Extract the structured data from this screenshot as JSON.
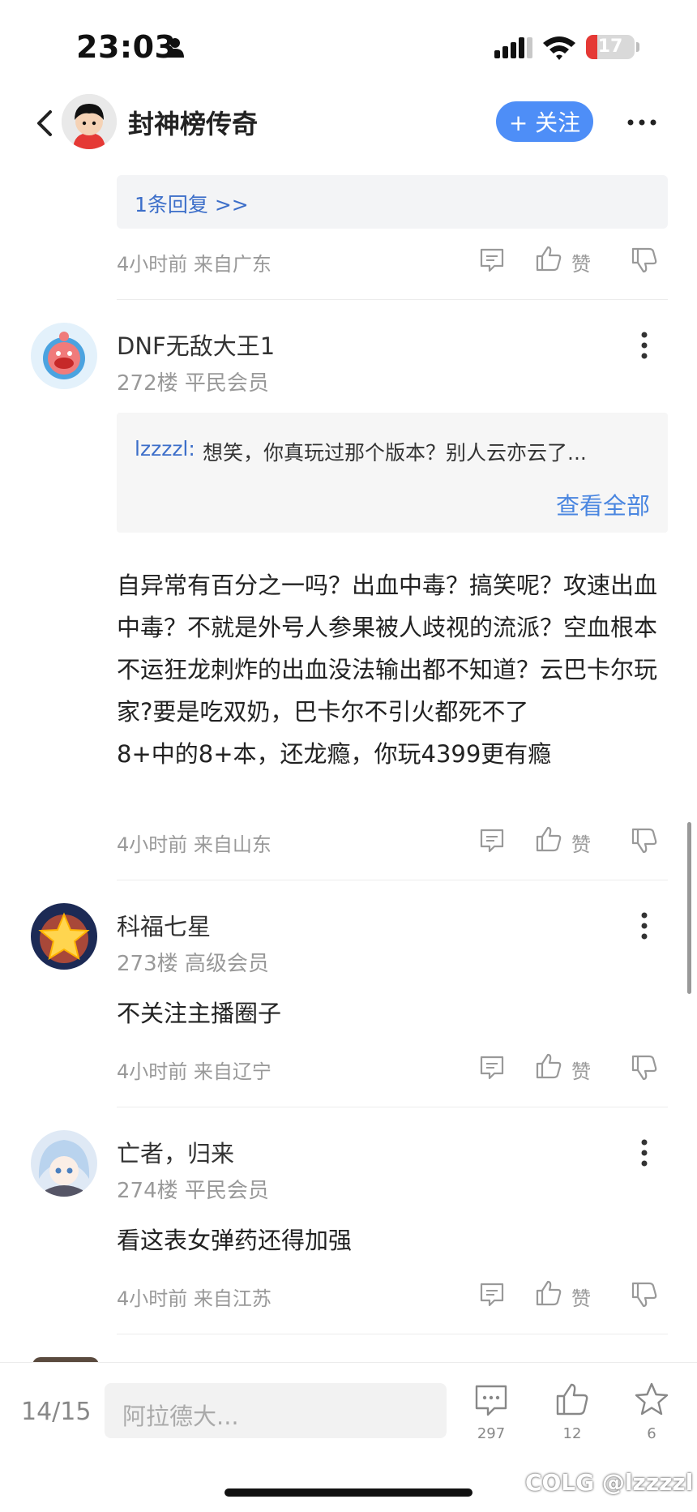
{
  "status_bar": {
    "time": "23:03",
    "battery": "17"
  },
  "nav": {
    "title": "封神榜传奇",
    "follow_label": "+ 关注"
  },
  "reply_box": {
    "link": "1条回复 >>"
  },
  "like_label": "赞",
  "top_meta": "4小时前 来自广东",
  "comments": [
    {
      "name": "DNF无敌大王1",
      "floor": "272楼 平民会员",
      "quote_user": "lzzzzl:",
      "quote_text": "想笑，你真玩过那个版本？别人云亦云了...",
      "quote_more": "查看全部",
      "body": "自异常有百分之一吗？出血中毒？搞笑呢？攻速出血中毒？不就是外号人参果被人歧视的流派？空血根本不运狂龙刺炸的出血没法输出都不知道？云巴卡尔玩家?要是吃双奶，巴卡尔不引火都死不了\n8+中的8+本，还龙瘾，你玩4399更有瘾",
      "meta": "4小时前 来自山东"
    },
    {
      "name": "科福七星",
      "floor": "273楼 高级会员",
      "body": "不关注主播圈子",
      "meta": "4小时前 来自辽宁"
    },
    {
      "name": "亡者，归来",
      "floor": "274楼 平民会员",
      "body": "看这表女弹药还得加强",
      "meta": "4小时前 来自江苏"
    }
  ],
  "bottom_bar": {
    "page": "14/15",
    "input_placeholder": "阿拉德大...",
    "comments_count": "297",
    "likes_count": "12",
    "favorites_count": "6"
  },
  "watermark": "COLG @lzzzzl"
}
